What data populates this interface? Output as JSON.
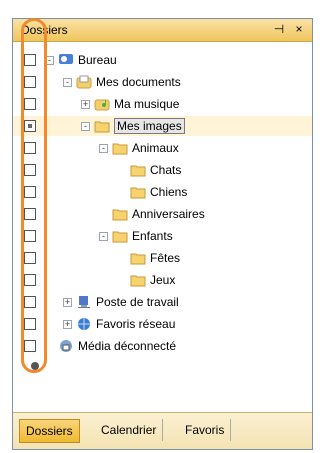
{
  "panel": {
    "title": "Dossiers",
    "pin_glyph": "⊣",
    "close_glyph": "×"
  },
  "tree": [
    {
      "label": "Bureau",
      "icon": "desktop-icon",
      "toggle": "-"
    },
    {
      "label": "Mes documents",
      "icon": "documents-icon",
      "toggle": "-"
    },
    {
      "label": "Ma musique",
      "icon": "music-folder-icon",
      "toggle": "+"
    },
    {
      "label": "Mes images",
      "icon": "folder-icon",
      "toggle": "-",
      "selected": true
    },
    {
      "label": "Animaux",
      "icon": "folder-icon",
      "toggle": "-"
    },
    {
      "label": "Chats",
      "icon": "folder-icon",
      "toggle": ""
    },
    {
      "label": "Chiens",
      "icon": "folder-icon",
      "toggle": ""
    },
    {
      "label": "Anniversaires",
      "icon": "folder-icon",
      "toggle": ""
    },
    {
      "label": "Enfants",
      "icon": "folder-icon",
      "toggle": "-"
    },
    {
      "label": "Fêtes",
      "icon": "folder-icon",
      "toggle": ""
    },
    {
      "label": "Jeux",
      "icon": "folder-icon",
      "toggle": ""
    },
    {
      "label": "Poste de travail",
      "icon": "computer-icon",
      "toggle": "+"
    },
    {
      "label": "Favoris réseau",
      "icon": "network-icon",
      "toggle": "+"
    },
    {
      "label": "Média déconnecté",
      "icon": "disconnected-media-icon",
      "toggle": ""
    }
  ],
  "checkboxes": [
    false,
    false,
    false,
    true,
    false,
    false,
    false,
    false,
    false,
    false,
    false,
    false,
    false,
    false
  ],
  "tabs": [
    {
      "label": "Dossiers",
      "active": true
    },
    {
      "label": "Calendrier",
      "active": false
    },
    {
      "label": "Favoris",
      "active": false
    }
  ],
  "colors": {
    "callout": "#f08a2c",
    "title_bg": "#f0c65c"
  }
}
